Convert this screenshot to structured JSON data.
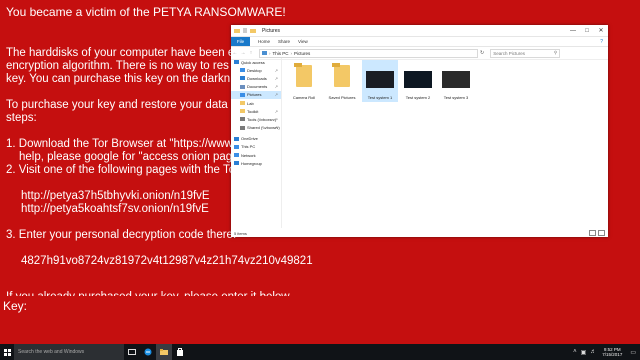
{
  "ransom": {
    "title": "You became a victim of the PETYA RANSOMWARE!",
    "lines": [
      "The harddisks of your computer have been e",
      "encryption algorithm. There is no way to res",
      "key. You can purchase this key on the darkn",
      "To purchase your key and restore your data",
      "steps:",
      "1. Download the Tor Browser at \"https://www",
      "help, please google for \"access onion pag",
      "2. Visit one of the following pages with the To",
      "http://petya37h5tbhyvki.onion/n19fvE",
      "http://petya5koahtsf7sv.onion/n19fvE",
      "3.  Enter your personal decryption code there:",
      "4827h91vo8724vz81972v4t12987v4z21h74vz210v49821",
      "If you already purchased your key, please enter it below."
    ],
    "key_label": "Key:"
  },
  "explorer": {
    "window_title": "Pictures",
    "ribbon_tabs": [
      "File",
      "Home",
      "Share",
      "View"
    ],
    "address": {
      "root": "This PC",
      "folder": "Pictures"
    },
    "search_placeholder": "Search Pictures",
    "nav": [
      {
        "label": "Quick access",
        "icon": "star-icon"
      },
      {
        "label": "Desktop",
        "icon": "desktop-icon",
        "pinned": true
      },
      {
        "label": "Downloads",
        "icon": "download-icon",
        "pinned": true
      },
      {
        "label": "Documents",
        "icon": "documents-icon",
        "pinned": true
      },
      {
        "label": "Pictures",
        "icon": "pictures-icon",
        "pinned": true,
        "selected": true
      },
      {
        "label": "Lab",
        "icon": "folder-icon"
      },
      {
        "label": "Toolkit",
        "icon": "folder-icon",
        "pinned": true
      },
      {
        "label": "Tools (\\\\vboxsrv)",
        "icon": "network-drive-icon",
        "pinned": true
      },
      {
        "label": "Shared (\\\\vboxsrv)",
        "icon": "network-drive-icon",
        "pinned": true
      },
      {
        "label": "OneDrive",
        "icon": "cloud-icon"
      },
      {
        "label": "This PC",
        "icon": "computer-icon"
      },
      {
        "label": "Network",
        "icon": "network-icon"
      },
      {
        "label": "Homegroup",
        "icon": "homegroup-icon"
      }
    ],
    "items": [
      {
        "label": "Camera Roll",
        "kind": "folder"
      },
      {
        "label": "Saved Pictures",
        "kind": "folder"
      },
      {
        "label": "Test system 1",
        "kind": "image",
        "selected": true
      },
      {
        "label": "Test system 2",
        "kind": "image"
      },
      {
        "label": "Test system 3",
        "kind": "image"
      }
    ],
    "status": "5 items"
  },
  "taskbar": {
    "search_placeholder": "Search the web and Windows",
    "clock_time": "9:52 PM",
    "clock_date": "7/15/2017"
  },
  "colors": {
    "ransom_bg": "#c50f0f",
    "accent": "#1979ca",
    "taskbar": "#101317"
  }
}
